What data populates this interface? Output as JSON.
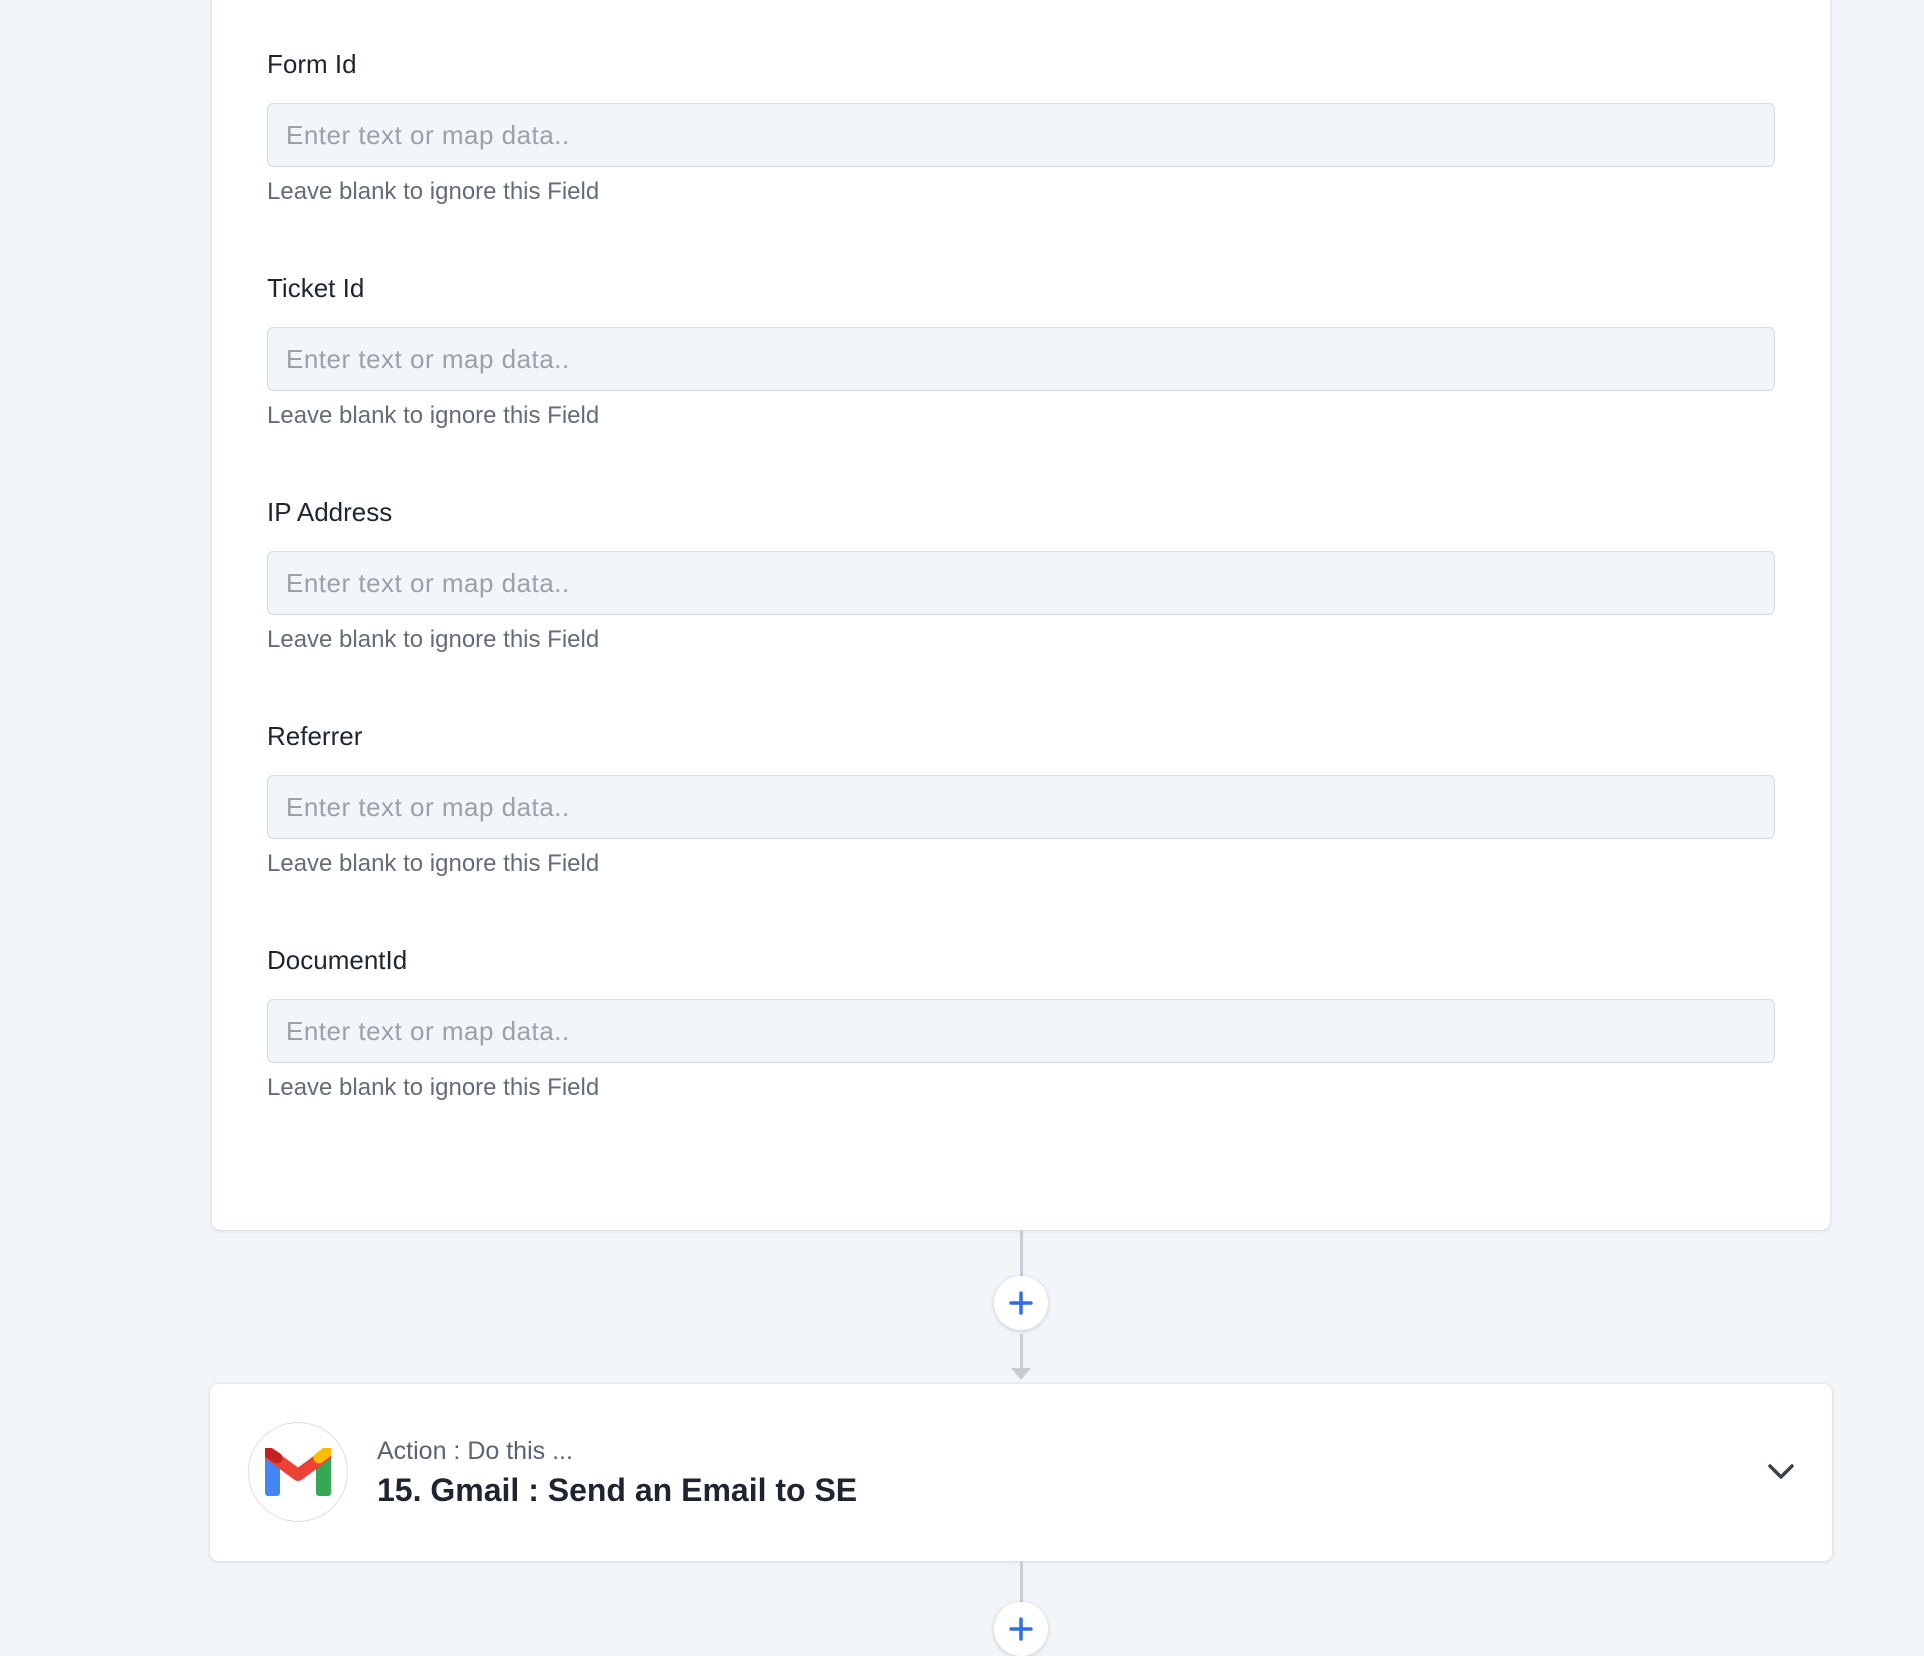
{
  "form": {
    "fields": [
      {
        "label": "Form Id",
        "placeholder": "Enter text or map data..",
        "value": "",
        "hint": "Leave blank to ignore this Field"
      },
      {
        "label": "Ticket Id",
        "placeholder": "Enter text or map data..",
        "value": "",
        "hint": "Leave blank to ignore this Field"
      },
      {
        "label": "IP Address",
        "placeholder": "Enter text or map data..",
        "value": "",
        "hint": "Leave blank to ignore this Field"
      },
      {
        "label": "Referrer",
        "placeholder": "Enter text or map data..",
        "value": "",
        "hint": "Leave blank to ignore this Field"
      },
      {
        "label": "DocumentId",
        "placeholder": "Enter text or map data..",
        "value": "",
        "hint": "Leave blank to ignore this Field"
      }
    ]
  },
  "action_step": {
    "subtitle": "Action : Do this ...",
    "title": "15. Gmail : Send an Email to SE",
    "app_icon": "gmail-logo-icon",
    "expand_icon": "chevron-down-icon"
  },
  "connector": {
    "add_icon": "plus-icon"
  },
  "colors": {
    "page_background": "#f3f6f9",
    "card_background": "#ffffff",
    "input_background": "#f3f6f9",
    "input_border": "#d6dbe2",
    "label_text": "#1f2530",
    "hint_text": "#656c77",
    "placeholder_text": "#9aa1ab",
    "accent_plus": "#2f6fde",
    "connector_line": "#c8cdd4"
  }
}
